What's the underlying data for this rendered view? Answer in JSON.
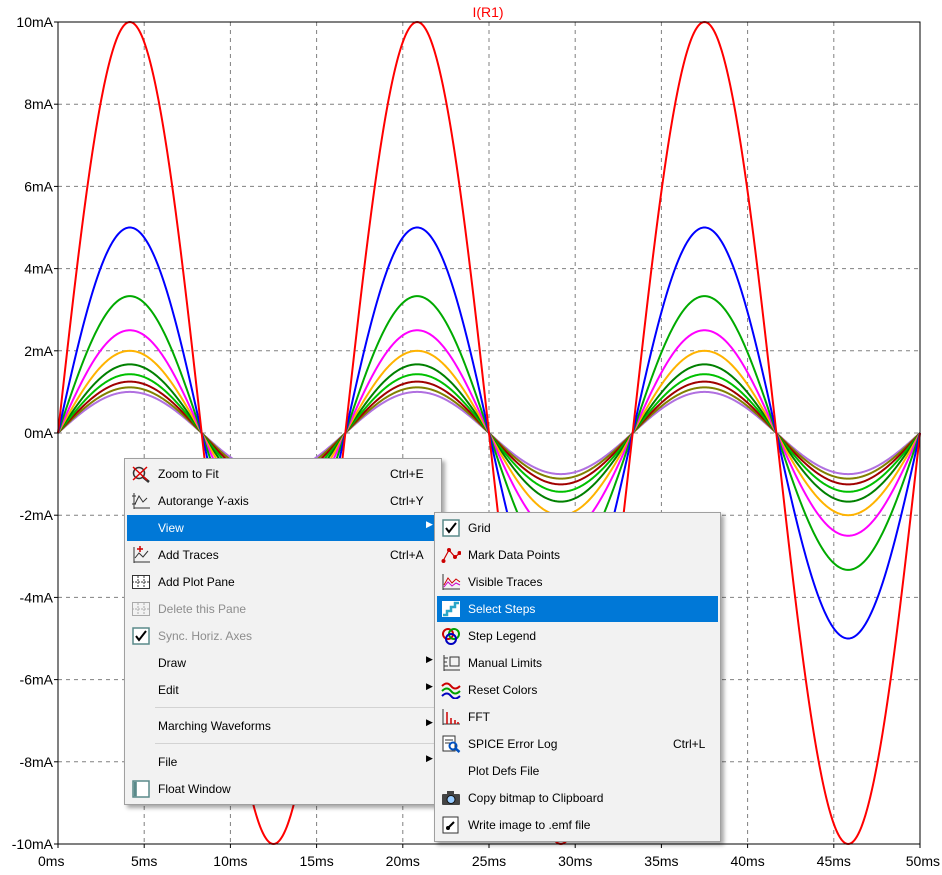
{
  "title": "I(R1)",
  "chart_data": {
    "type": "line",
    "title": "I(R1)",
    "xlabel": "",
    "ylabel": "",
    "x_unit": "ms",
    "y_unit": "mA",
    "xlim": [
      0,
      50
    ],
    "ylim": [
      -10,
      10
    ],
    "x_ticks": [
      "0ms",
      "5ms",
      "10ms",
      "15ms",
      "20ms",
      "25ms",
      "30ms",
      "35ms",
      "40ms",
      "45ms",
      "50ms"
    ],
    "y_ticks": [
      "10mA",
      "8mA",
      "6mA",
      "4mA",
      "2mA",
      "0mA",
      "-2mA",
      "-4mA",
      "-6mA",
      "-8mA",
      "-10mA"
    ],
    "grid": true,
    "frequency_hz": 60,
    "waveform": "sine",
    "series": [
      {
        "amplitude_mA": 10.0,
        "color": "#ff0000"
      },
      {
        "amplitude_mA": 5.0,
        "color": "#0000ff"
      },
      {
        "amplitude_mA": 3.33,
        "color": "#00aa00"
      },
      {
        "amplitude_mA": 2.5,
        "color": "#ff00ff"
      },
      {
        "amplitude_mA": 2.0,
        "color": "#ffb300"
      },
      {
        "amplitude_mA": 1.67,
        "color": "#008000"
      },
      {
        "amplitude_mA": 1.43,
        "color": "#00c000"
      },
      {
        "amplitude_mA": 1.25,
        "color": "#a00000"
      },
      {
        "amplitude_mA": 1.11,
        "color": "#808000"
      },
      {
        "amplitude_mA": 1.0,
        "color": "#b070e0"
      }
    ]
  },
  "context_menu": {
    "items": [
      {
        "label": "Zoom to Fit",
        "shortcut": "Ctrl+E",
        "icon": "zoom-fit-icon"
      },
      {
        "label": "Autorange Y-axis",
        "shortcut": "Ctrl+Y",
        "icon": "autorange-icon"
      },
      {
        "label": "View",
        "submenu": true
      },
      {
        "label": "Add Traces",
        "shortcut": "Ctrl+A",
        "icon": "add-traces-icon"
      },
      {
        "label": "Add Plot Pane",
        "icon": "add-pane-icon"
      },
      {
        "label": "Delete this Pane",
        "disabled": true,
        "icon": "delete-pane-icon"
      },
      {
        "label": "Sync. Horiz. Axes",
        "disabled": true,
        "checked": true,
        "icon": "check-icon"
      },
      {
        "label": "Draw",
        "submenu": true
      },
      {
        "label": "Edit",
        "submenu": true
      },
      {
        "label": "Marching Waveforms",
        "submenu": true
      },
      {
        "label": "File",
        "submenu": true
      },
      {
        "label": "Float Window",
        "icon": "float-window-icon"
      }
    ]
  },
  "view_submenu": {
    "items": [
      {
        "label": "Grid",
        "checked": true,
        "icon": "check-icon"
      },
      {
        "label": "Mark Data Points",
        "icon": "mark-points-icon"
      },
      {
        "label": "Visible Traces",
        "icon": "visible-traces-icon"
      },
      {
        "label": "Select Steps",
        "icon": "select-steps-icon",
        "highlighted": true
      },
      {
        "label": "Step Legend",
        "icon": "step-legend-icon"
      },
      {
        "label": "Manual Limits",
        "icon": "manual-limits-icon"
      },
      {
        "label": "Reset Colors",
        "icon": "reset-colors-icon"
      },
      {
        "label": "FFT",
        "icon": "fft-icon"
      },
      {
        "label": "SPICE Error Log",
        "shortcut": "Ctrl+L",
        "icon": "error-log-icon"
      },
      {
        "label": "Plot Defs File"
      },
      {
        "label": "Copy bitmap to Clipboard",
        "icon": "camera-icon"
      },
      {
        "label": "Write image to .emf file",
        "icon": "emf-icon"
      }
    ]
  }
}
